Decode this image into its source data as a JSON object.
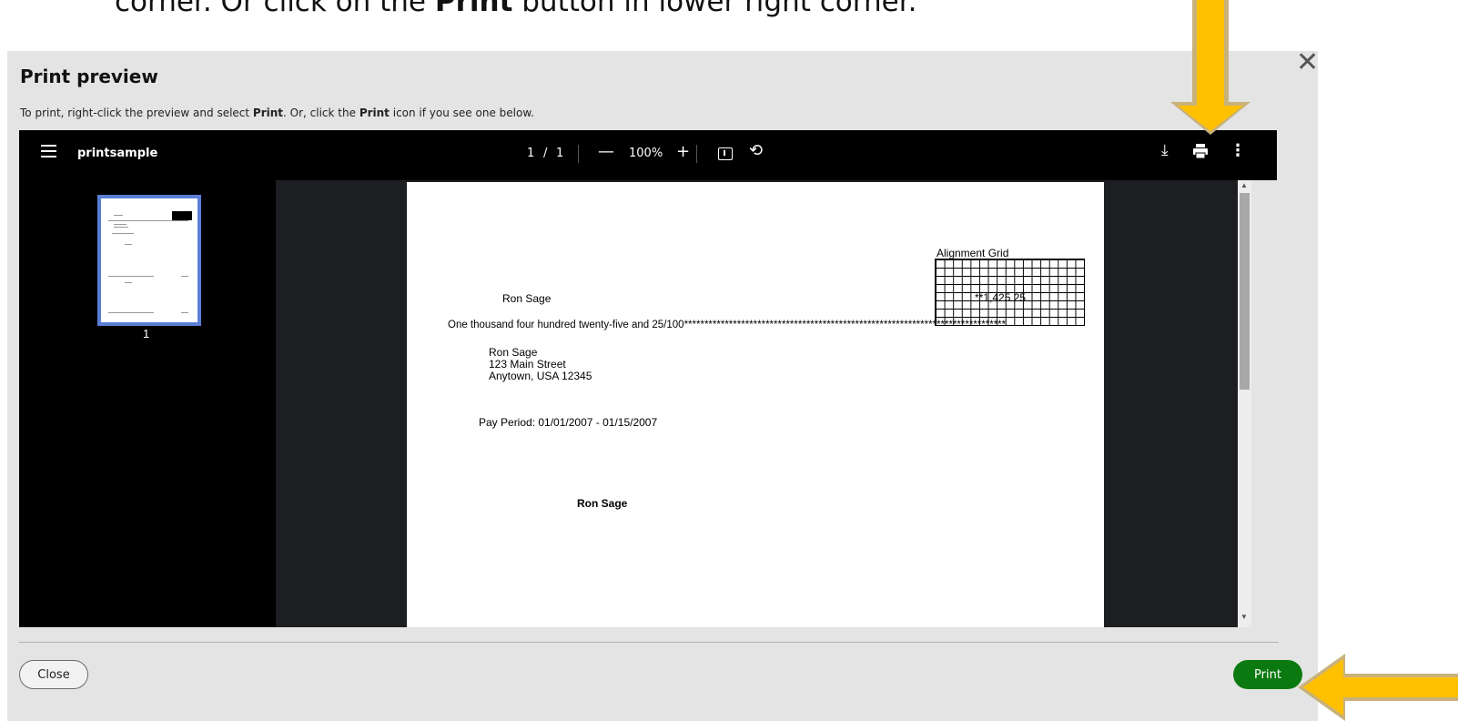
{
  "caption": {
    "before": "corner. Or click on the ",
    "bold": "Print",
    "after": " button in lower right corner."
  },
  "dialog": {
    "title": "Print preview",
    "instructions": {
      "part1": "To print, right-click the preview and select ",
      "bold1": "Print",
      "part2": ". Or, click the ",
      "bold2": "Print",
      "part3": " icon if you see one below."
    },
    "close_icon": "close-icon",
    "close_label": "Close",
    "print_label": "Print",
    "print_color": "#0a7a10"
  },
  "viewer": {
    "doc_title": "printsample",
    "page_current": "1",
    "page_sep": "/",
    "page_total": "1",
    "zoom_out": "—",
    "zoom_level": "100%",
    "zoom_in": "+",
    "icons": [
      "menu-icon",
      "fit-page-icon",
      "rotate-icon",
      "download-icon",
      "print-icon",
      "more-options-icon"
    ],
    "thumb_page_number": "1",
    "thumb_border_color": "#5b7fd6"
  },
  "document": {
    "grid_label": "Alignment Grid",
    "payee": "Ron Sage",
    "amount": "**1,425.25",
    "amount_words": "One thousand four hundred twenty-five and 25/100*******************************************************************************",
    "address_name": "Ron Sage",
    "address_street": "123 Main Street",
    "address_city": "Anytown, USA 12345",
    "pay_period": "Pay Period: 01/01/2007 - 01/15/2007",
    "signature_name": "Ron Sage"
  },
  "annotations": {
    "arrow_color": "#ffc000",
    "arrow_outline": "#c9b27a"
  }
}
